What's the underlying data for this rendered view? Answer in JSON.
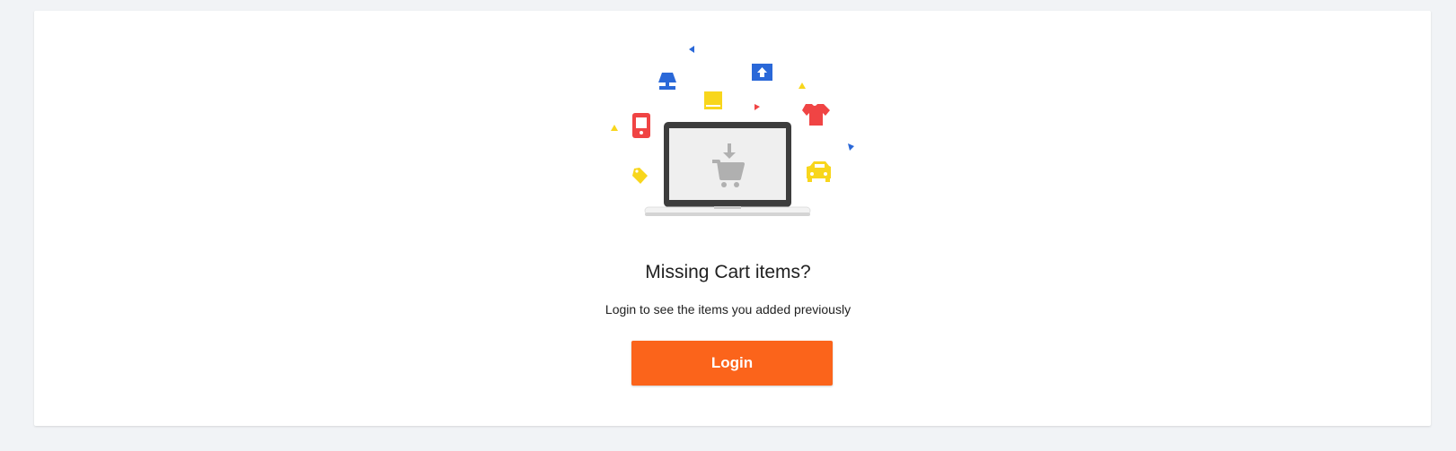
{
  "empty_cart": {
    "title": "Missing Cart items?",
    "subtitle": "Login to see the items you added previously",
    "login_button_label": "Login"
  },
  "colors": {
    "page_background": "#f1f3f6",
    "card_background": "#ffffff",
    "button": "#fb641b",
    "icon_blue": "#2a68d8",
    "icon_yellow": "#f8d61c",
    "icon_red": "#f04444",
    "laptop_frame": "#3d3d3d",
    "laptop_screen": "#efefef",
    "cart_icon": "#b0b0b0"
  },
  "illustration_icons": [
    "laptop-icon",
    "cart-download-icon",
    "lamp-icon",
    "tv-icon",
    "book-icon",
    "phone-icon",
    "tshirt-icon",
    "tag-icon",
    "car-icon"
  ]
}
